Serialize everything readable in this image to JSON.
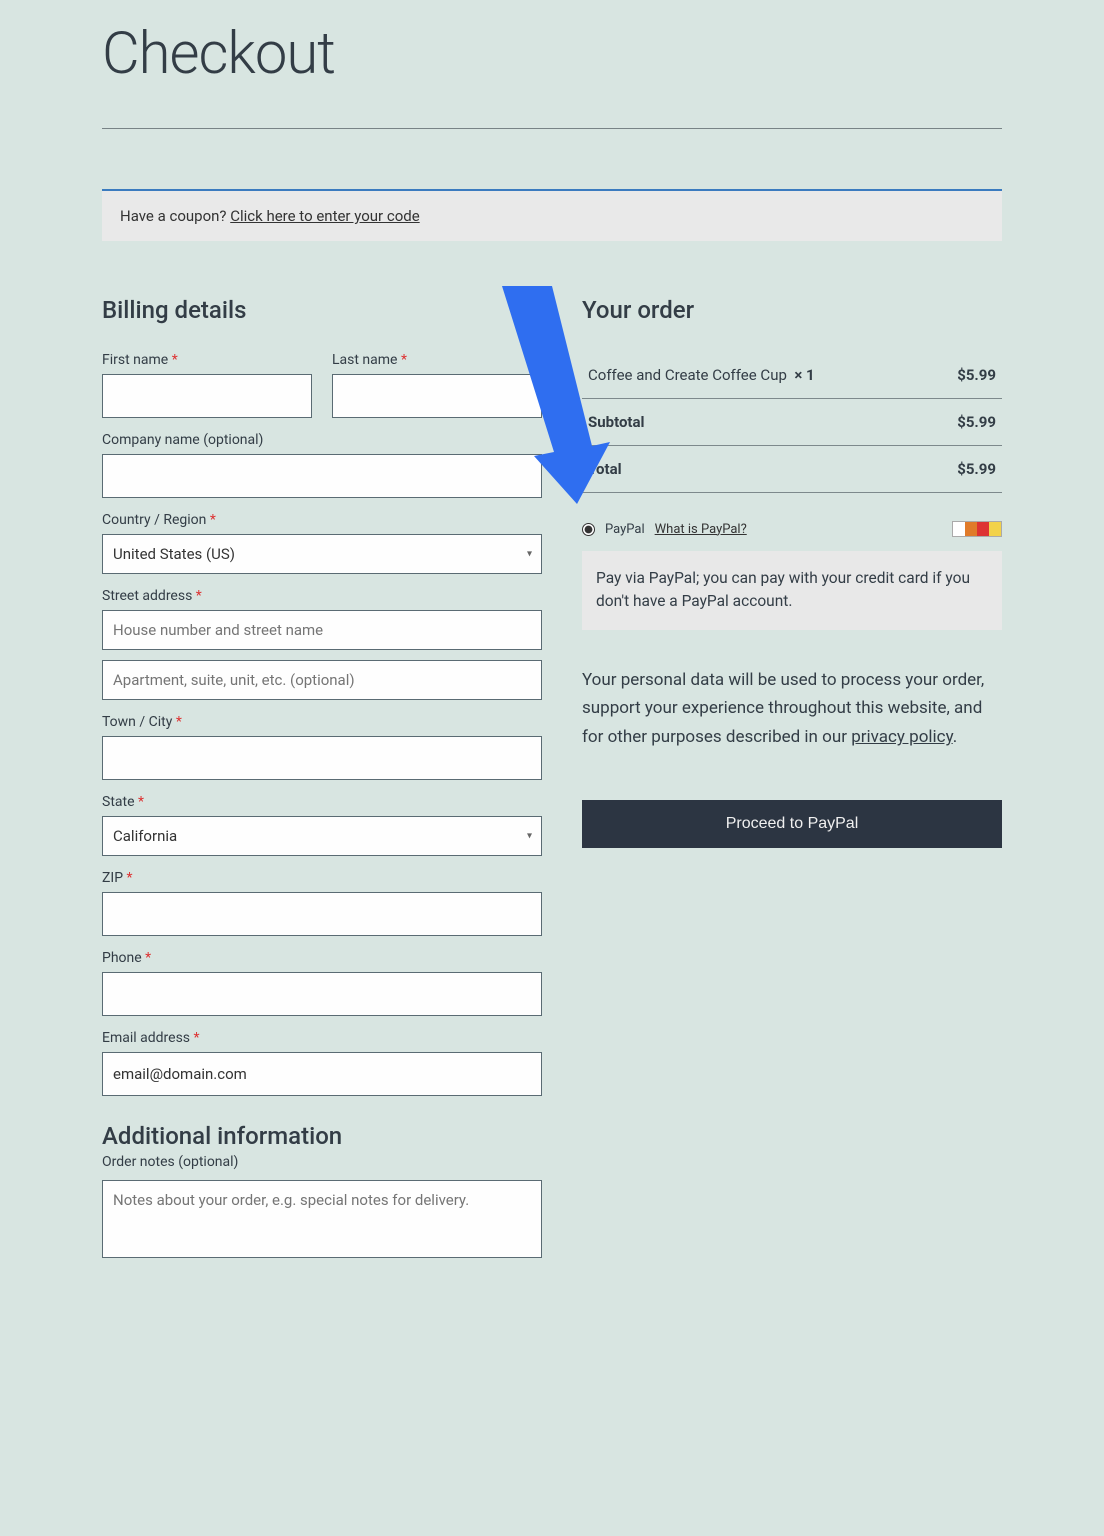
{
  "page": {
    "title": "Checkout"
  },
  "coupon": {
    "prompt": "Have a coupon? ",
    "link_text": "Click here to enter your code"
  },
  "billing": {
    "title": "Billing details",
    "first_name_label": "First name",
    "last_name_label": "Last name",
    "company_label": "Company name (optional)",
    "country_label": "Country / Region",
    "country_value": "United States (US)",
    "street_label": "Street address",
    "street_ph1": "House number and street name",
    "street_ph2": "Apartment, suite, unit, etc. (optional)",
    "city_label": "Town / City",
    "state_label": "State",
    "state_value": "California",
    "zip_label": "ZIP",
    "phone_label": "Phone",
    "email_label": "Email address",
    "email_value": "email@domain.com"
  },
  "additional": {
    "title": "Additional information",
    "notes_label": "Order notes (optional)",
    "notes_ph": "Notes about your order, e.g. special notes for delivery."
  },
  "order": {
    "title": "Your order",
    "item_name": "Coffee and Create Coffee Cup",
    "item_qty": "× 1",
    "item_price": "$5.99",
    "subtotal_label": "Subtotal",
    "subtotal_value": "$5.99",
    "total_label": "Total",
    "total_value": "$5.99"
  },
  "payment": {
    "method_label": "PayPal",
    "what_is": "What is PayPal?",
    "desc": "Pay via PayPal; you can pay with your credit card if you don't have a PayPal account."
  },
  "privacy": {
    "text": "Your personal data will be used to process your order, support your experience throughout this website, and for other purposes described in our ",
    "link": "privacy policy",
    "after": "."
  },
  "proceed_label": "Proceed to PayPal"
}
